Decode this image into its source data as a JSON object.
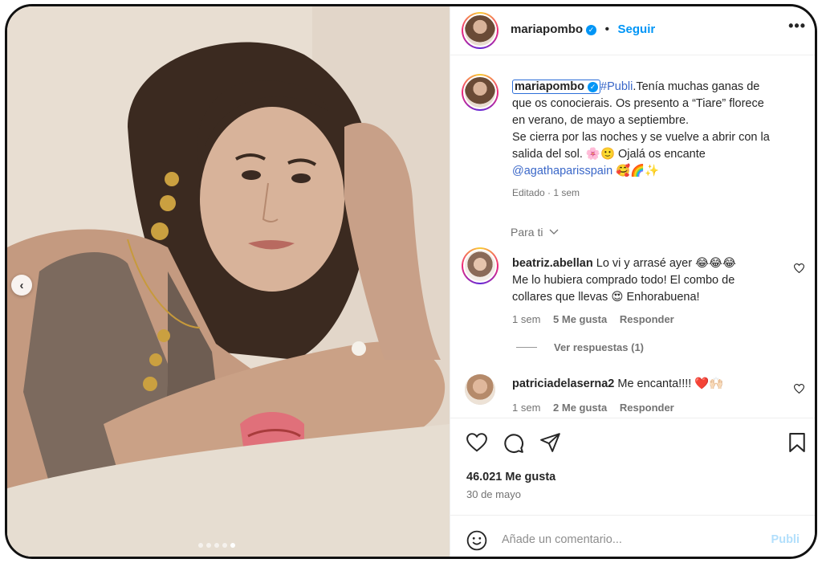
{
  "post": {
    "username": "mariapombo",
    "follow_label": "Seguir",
    "more_label": "•••",
    "hashtag": "#Publi",
    "caption_lines": [
      ".Tenía muchas ganas de",
      "que os conocierais. Os presento a “Tiare” florece",
      "en verano, de mayo a septiembre.",
      "Se cierra por las noches y se vuelve a abrir con la",
      "salida del sol. 🌸🙂 Ojalá os encante"
    ],
    "mention": "@agathaparisspain",
    "mention_emojis": "🥰🌈✨",
    "edited": "Editado",
    "edited_age": "1 sem",
    "for_you": "Para ti"
  },
  "comments": [
    {
      "username": "beatriz.abellan",
      "lines": [
        "Lo vi y arrasé ayer 😂😂😂",
        "Me lo hubiera comprado todo! El combo de",
        "collares que llevas 😍 Enhorabuena!"
      ],
      "age": "1 sem",
      "likes": "5 Me gusta",
      "reply": "Responder",
      "view_replies": "Ver respuestas (1)"
    },
    {
      "username": "patriciadelaserna2",
      "lines": [
        "Me encanta!!!! ❤️🙌🏻"
      ],
      "age": "1 sem",
      "likes": "2 Me gusta",
      "reply": "Responder"
    }
  ],
  "stats": {
    "likes": "46.021 Me gusta",
    "date": "30 de mayo"
  },
  "composer": {
    "placeholder": "Añade un comentario...",
    "publish": "Publi"
  },
  "carousel": {
    "prev_glyph": "‹",
    "slide_count": 5,
    "active_slide": 5
  },
  "colors": {
    "accent": "#0095f6",
    "link": "#3a67c8",
    "muted": "#737373"
  }
}
